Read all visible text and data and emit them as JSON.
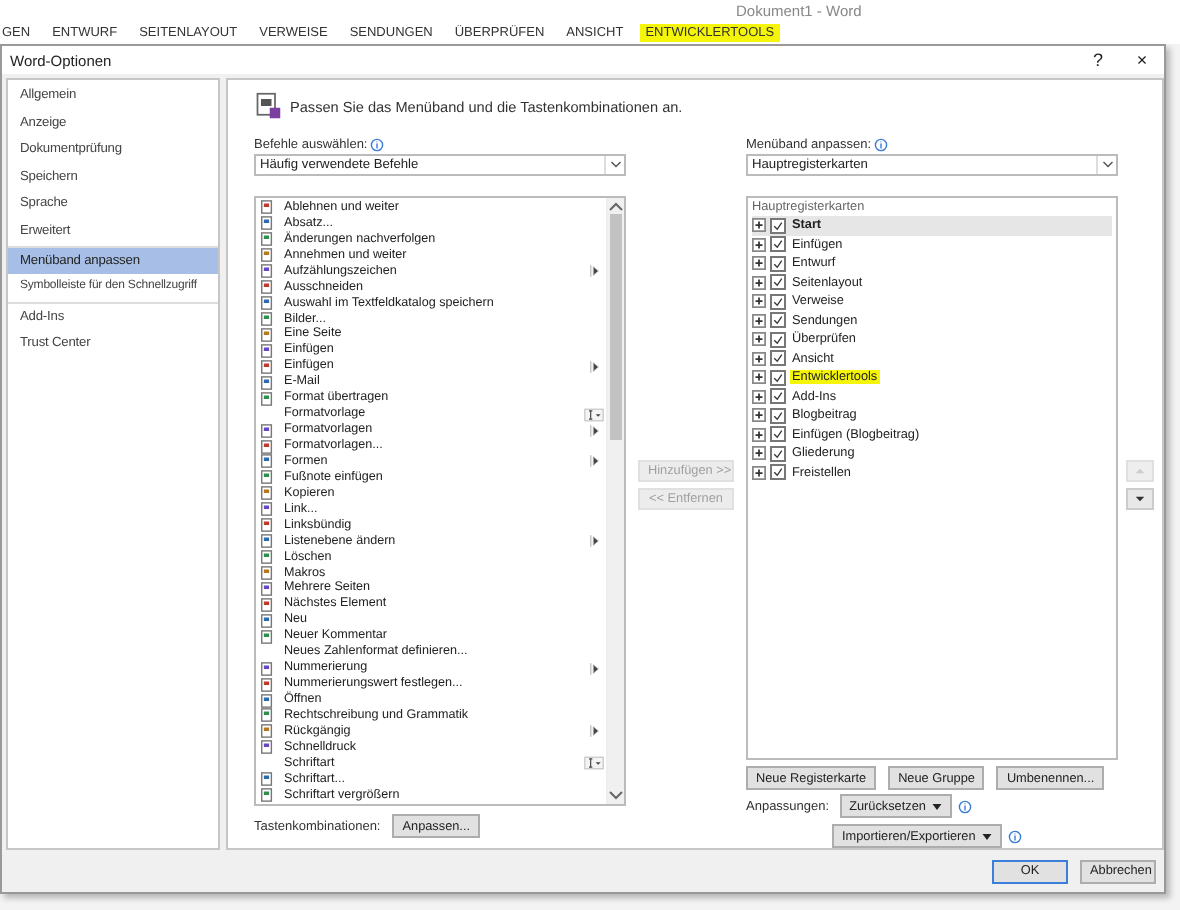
{
  "app": {
    "title": "Dokument1 - Word",
    "tabs": [
      {
        "label": "GEN",
        "highlighted": false
      },
      {
        "label": "ENTWURF",
        "highlighted": false
      },
      {
        "label": "SEITENLAYOUT",
        "highlighted": false
      },
      {
        "label": "VERWEISE",
        "highlighted": false
      },
      {
        "label": "SENDUNGEN",
        "highlighted": false
      },
      {
        "label": "ÜBERPRÜFEN",
        "highlighted": false
      },
      {
        "label": "ANSICHT",
        "highlighted": false
      },
      {
        "label": "ENTWICKLERTOOLS",
        "highlighted": true
      }
    ]
  },
  "dialog": {
    "title": "Word-Optionen",
    "help": "?",
    "close": "×"
  },
  "sidebar": {
    "groups": [
      [
        {
          "label": "Allgemein",
          "selected": false
        },
        {
          "label": "Anzeige",
          "selected": false
        },
        {
          "label": "Dokumentprüfung",
          "selected": false
        },
        {
          "label": "Speichern",
          "selected": false
        },
        {
          "label": "Sprache",
          "selected": false
        },
        {
          "label": "Erweitert",
          "selected": false
        }
      ],
      [
        {
          "label": "Menüband anpassen",
          "selected": true
        },
        {
          "label": "Symbolleiste für den Schnellzugriff",
          "selected": false
        }
      ],
      [
        {
          "label": "Add-Ins",
          "selected": false
        },
        {
          "label": "Trust Center",
          "selected": false
        }
      ]
    ]
  },
  "heading": "Passen Sie das Menüband und die Tastenkombinationen an.",
  "commands": {
    "label": "Befehle auswählen:",
    "value": "Häufig verwendete Befehle",
    "items": [
      {
        "label": "Ablehnen und weiter",
        "has_icon": true,
        "submenu": false,
        "picker": false
      },
      {
        "label": "Absatz...",
        "has_icon": true,
        "submenu": false,
        "picker": false
      },
      {
        "label": "Änderungen nachverfolgen",
        "has_icon": true,
        "submenu": false,
        "picker": false
      },
      {
        "label": "Annehmen und weiter",
        "has_icon": true,
        "submenu": false,
        "picker": false
      },
      {
        "label": "Aufzählungszeichen",
        "has_icon": true,
        "submenu": true,
        "picker": false
      },
      {
        "label": "Ausschneiden",
        "has_icon": true,
        "submenu": false,
        "picker": false
      },
      {
        "label": "Auswahl im Textfeldkatalog speichern",
        "has_icon": true,
        "submenu": false,
        "picker": false
      },
      {
        "label": "Bilder...",
        "has_icon": true,
        "submenu": false,
        "picker": false
      },
      {
        "label": "Eine Seite",
        "has_icon": true,
        "submenu": false,
        "picker": false
      },
      {
        "label": "Einfügen",
        "has_icon": true,
        "submenu": false,
        "picker": false
      },
      {
        "label": "Einfügen",
        "has_icon": true,
        "submenu": true,
        "picker": false
      },
      {
        "label": "E-Mail",
        "has_icon": true,
        "submenu": false,
        "picker": false
      },
      {
        "label": "Format übertragen",
        "has_icon": true,
        "submenu": false,
        "picker": false
      },
      {
        "label": "Formatvorlage",
        "has_icon": false,
        "submenu": false,
        "picker": true
      },
      {
        "label": "Formatvorlagen",
        "has_icon": true,
        "submenu": true,
        "picker": false
      },
      {
        "label": "Formatvorlagen...",
        "has_icon": true,
        "submenu": false,
        "picker": false
      },
      {
        "label": "Formen",
        "has_icon": true,
        "submenu": true,
        "picker": false
      },
      {
        "label": "Fußnote einfügen",
        "has_icon": true,
        "submenu": false,
        "picker": false
      },
      {
        "label": "Kopieren",
        "has_icon": true,
        "submenu": false,
        "picker": false
      },
      {
        "label": "Link...",
        "has_icon": true,
        "submenu": false,
        "picker": false
      },
      {
        "label": "Linksbündig",
        "has_icon": true,
        "submenu": false,
        "picker": false
      },
      {
        "label": "Listenebene ändern",
        "has_icon": true,
        "submenu": true,
        "picker": false
      },
      {
        "label": "Löschen",
        "has_icon": true,
        "submenu": false,
        "picker": false
      },
      {
        "label": "Makros",
        "has_icon": true,
        "submenu": false,
        "picker": false
      },
      {
        "label": "Mehrere Seiten",
        "has_icon": true,
        "submenu": false,
        "picker": false
      },
      {
        "label": "Nächstes Element",
        "has_icon": true,
        "submenu": false,
        "picker": false
      },
      {
        "label": "Neu",
        "has_icon": true,
        "submenu": false,
        "picker": false
      },
      {
        "label": "Neuer Kommentar",
        "has_icon": true,
        "submenu": false,
        "picker": false
      },
      {
        "label": "Neues Zahlenformat definieren...",
        "has_icon": false,
        "submenu": false,
        "picker": false
      },
      {
        "label": "Nummerierung",
        "has_icon": true,
        "submenu": true,
        "picker": false
      },
      {
        "label": "Nummerierungswert festlegen...",
        "has_icon": true,
        "submenu": false,
        "picker": false
      },
      {
        "label": "Öffnen",
        "has_icon": true,
        "submenu": false,
        "picker": false
      },
      {
        "label": "Rechtschreibung und Grammatik",
        "has_icon": true,
        "submenu": false,
        "picker": false
      },
      {
        "label": "Rückgängig",
        "has_icon": true,
        "submenu": true,
        "picker": false
      },
      {
        "label": "Schnelldruck",
        "has_icon": true,
        "submenu": false,
        "picker": false
      },
      {
        "label": "Schriftart",
        "has_icon": false,
        "submenu": false,
        "picker": true
      },
      {
        "label": "Schriftart...",
        "has_icon": true,
        "submenu": false,
        "picker": false
      },
      {
        "label": "Schriftart vergrößern",
        "has_icon": true,
        "submenu": false,
        "picker": false
      }
    ]
  },
  "shortcuts": {
    "label": "Tastenkombinationen:",
    "button": "Anpassen..."
  },
  "move_buttons": [
    {
      "label": "Hinzufügen >>",
      "disabled": true
    },
    {
      "label": "<< Entfernen",
      "disabled": true
    }
  ],
  "order_buttons": [
    {
      "disabled": true
    },
    {
      "disabled": false
    }
  ],
  "ribbon": {
    "label": "Menüband anpassen:",
    "value": "Hauptregisterkarten",
    "header": "Hauptregisterkarten",
    "items": [
      {
        "label": "Start",
        "checked": true,
        "selected": true,
        "highlighted": false
      },
      {
        "label": "Einfügen",
        "checked": true,
        "selected": false,
        "highlighted": false
      },
      {
        "label": "Entwurf",
        "checked": true,
        "selected": false,
        "highlighted": false
      },
      {
        "label": "Seitenlayout",
        "checked": true,
        "selected": false,
        "highlighted": false
      },
      {
        "label": "Verweise",
        "checked": true,
        "selected": false,
        "highlighted": false
      },
      {
        "label": "Sendungen",
        "checked": true,
        "selected": false,
        "highlighted": false
      },
      {
        "label": "Überprüfen",
        "checked": true,
        "selected": false,
        "highlighted": false
      },
      {
        "label": "Ansicht",
        "checked": true,
        "selected": false,
        "highlighted": false
      },
      {
        "label": "Entwicklertools",
        "checked": true,
        "selected": false,
        "highlighted": true
      },
      {
        "label": "Add-Ins",
        "checked": true,
        "selected": false,
        "highlighted": false
      },
      {
        "label": "Blogbeitrag",
        "checked": true,
        "selected": false,
        "highlighted": false
      },
      {
        "label": "Einfügen (Blogbeitrag)",
        "checked": true,
        "selected": false,
        "highlighted": false
      },
      {
        "label": "Gliederung",
        "checked": true,
        "selected": false,
        "highlighted": false
      },
      {
        "label": "Freistellen",
        "checked": true,
        "selected": false,
        "highlighted": false
      }
    ],
    "buttons": [
      "Neue Registerkarte",
      "Neue Gruppe",
      "Umbenennen..."
    ],
    "customizations_label": "Anpassungen:",
    "reset": "Zurücksetzen",
    "import_export": "Importieren/Exportieren"
  },
  "footer": {
    "ok": "OK",
    "cancel": "Abbrechen"
  }
}
